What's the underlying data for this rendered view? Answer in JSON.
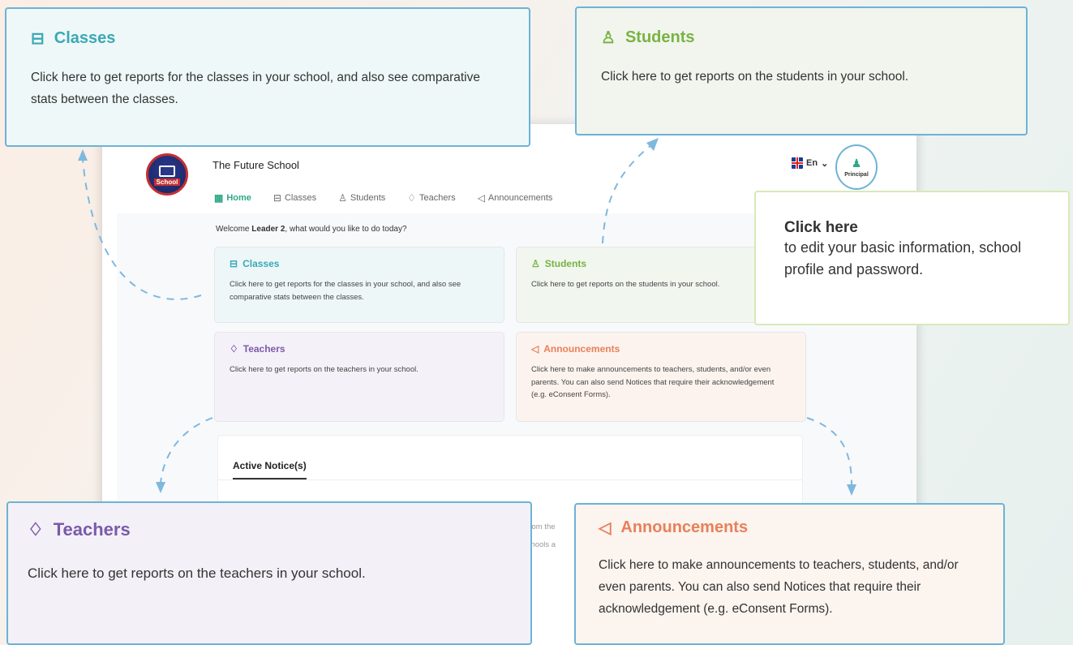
{
  "app": {
    "school_name": "The Future School",
    "logo_text": "School",
    "nav": [
      {
        "label": "Home",
        "icon": "grid-icon"
      },
      {
        "label": "Classes",
        "icon": "monitor-icon"
      },
      {
        "label": "Students",
        "icon": "student-icon"
      },
      {
        "label": "Teachers",
        "icon": "teacher-icon"
      },
      {
        "label": "Announcements",
        "icon": "megaphone-icon"
      }
    ],
    "language": "En",
    "profile_label": "Principal",
    "welcome_prefix": "Welcome ",
    "welcome_name": "Leader 2",
    "welcome_suffix": ", what would you like to do today?",
    "cards": {
      "classes": {
        "title": "Classes",
        "desc": "Click here to get reports for the classes in your school, and also see comparative stats between the classes."
      },
      "students": {
        "title": "Students",
        "desc": "Click here to get reports on the students in your school."
      },
      "teachers": {
        "title": "Teachers",
        "desc": "Click here to get reports on the teachers in your school."
      },
      "announcements": {
        "title": "Announcements",
        "desc": "Click here to make announcements to teachers, students, and/or even parents. You can also send Notices that require their acknowledgement (e.g. eConsent Forms)."
      }
    },
    "notice_tab": "Active Notice(s)",
    "notice_fragment_1": "ce from the",
    "notice_fragment_2": "e schools a"
  },
  "callouts": {
    "classes": {
      "title": "Classes",
      "desc": "Click here to get reports for the classes in your school, and also see comparative stats between the classes."
    },
    "students": {
      "title": "Students",
      "desc": "Click here to get reports on the students in your school."
    },
    "profile": {
      "title": "Click here",
      "desc": "to edit your basic information, school profile and password."
    },
    "teachers": {
      "title": "Teachers",
      "desc": "Click here to get reports on the teachers in your school."
    },
    "announcements": {
      "title": "Announcements",
      "desc": "Click here to make announcements to teachers, students, and/or even parents. You can also send Notices that require their acknowledgement (e.g. eConsent Forms)."
    }
  },
  "colors": {
    "classes": "#3aa9b6",
    "students": "#79b343",
    "teachers": "#7a5aa8",
    "announcements": "#e9805a",
    "callout_border": "#6cb3d6"
  }
}
